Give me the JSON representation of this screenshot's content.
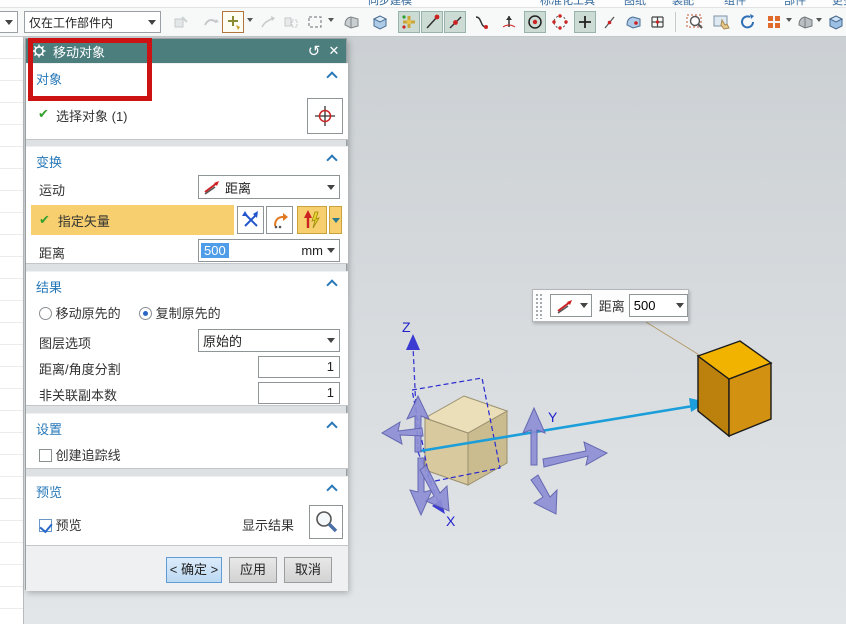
{
  "ribbon_clipped_labels": [
    "同步建模",
    "标准化工具",
    "图纸",
    "装配",
    "组件",
    "部件",
    "更多"
  ],
  "toolbar": {
    "scope_value": "仅在工作部件内",
    "icons": [
      "assembly-constraints",
      "move-component",
      "move-face",
      "pattern-feature",
      "mirror-feature",
      "rectangle-select",
      "face-rule",
      "body-select",
      "snap-handles",
      "endpoint-snap",
      "midpoint-snap",
      "point-on-curve-snap",
      "tangent-snap",
      "circle-center-snap",
      "quadrant-snap",
      "point-snap",
      "point-on-line-snap",
      "face-point-snap",
      "grid-point-snap",
      "zoom",
      "pan",
      "rotate",
      "perspective",
      "render-style",
      "show-body"
    ]
  },
  "dialog": {
    "title": "移动对象",
    "object_section": {
      "title": "对象",
      "select_object": "选择对象 (1)"
    },
    "transform_section": {
      "title": "变换",
      "motion_label": "运动",
      "motion_value": "距离",
      "vector_label": "指定矢量",
      "distance_label": "距离",
      "distance_value": "500",
      "distance_unit": "mm"
    },
    "result_section": {
      "title": "结果",
      "move_original": "移动原先的",
      "copy_original": "复制原先的",
      "layer_option_label": "图层选项",
      "layer_option_value": "原始的",
      "division_label": "距离/角度分割",
      "division_value": "1",
      "copies_label": "非关联副本数",
      "copies_value": "1"
    },
    "settings_section": {
      "title": "设置",
      "traceline": "创建追踪线"
    },
    "preview_section": {
      "title": "预览",
      "preview": "预览",
      "show_result": "显示结果"
    },
    "buttons": {
      "ok": "< 确定 >",
      "apply": "应用",
      "cancel": "取消"
    }
  },
  "viewport": {
    "mini_toolbar": {
      "distance_label": "距离",
      "distance_value": "500"
    },
    "axis_labels": {
      "x": "X",
      "y": "Y",
      "z": "Z"
    }
  },
  "glyphs": {
    "reset": "↺",
    "close": "✕",
    "check": "✔"
  },
  "colors": {
    "dialog_header": "#4d7e7e",
    "section_title": "#2878b8",
    "highlight_row": "#f7cf6e",
    "selection_blue": "#4f9ce8",
    "annotation_red": "#cc1212",
    "vector_cyan": "#1b9ed9",
    "tan_cube_top": "#e8dcb4",
    "orange_cube_top": "#f2b300"
  }
}
